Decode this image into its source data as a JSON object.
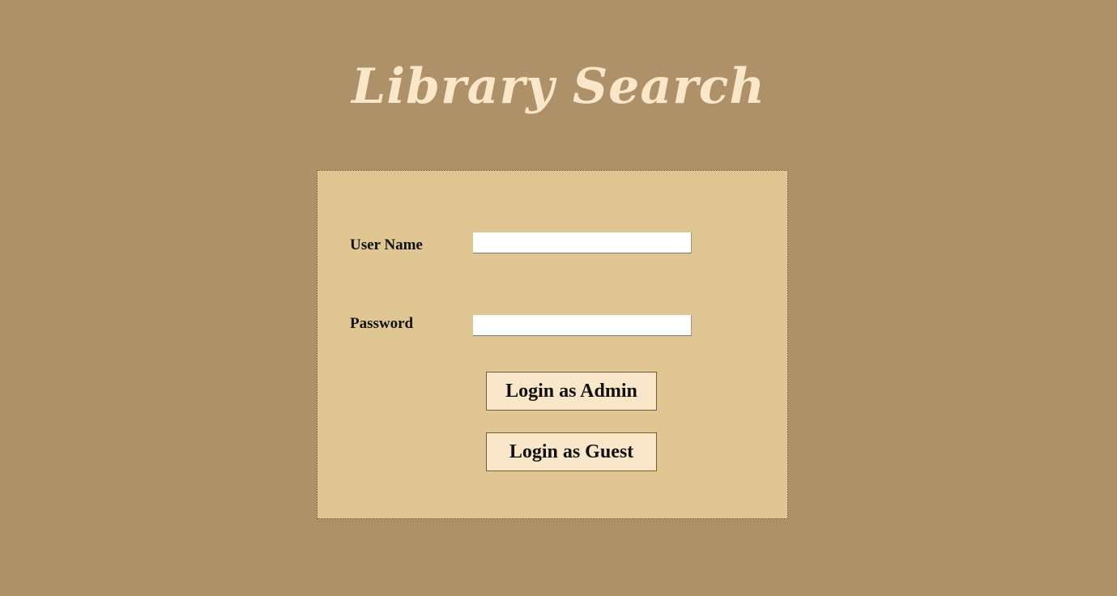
{
  "header": {
    "title": "Library Search"
  },
  "login_form": {
    "username_label": "User Name",
    "username_value": "",
    "password_label": "Password",
    "password_value": "",
    "admin_button_label": "Login as Admin",
    "guest_button_label": "Login as Guest"
  },
  "colors": {
    "background": "#ae9069",
    "panel": "#e0c692",
    "title": "#fae6c8",
    "button": "#fae6c8",
    "button_border": "#7a5a2e"
  }
}
